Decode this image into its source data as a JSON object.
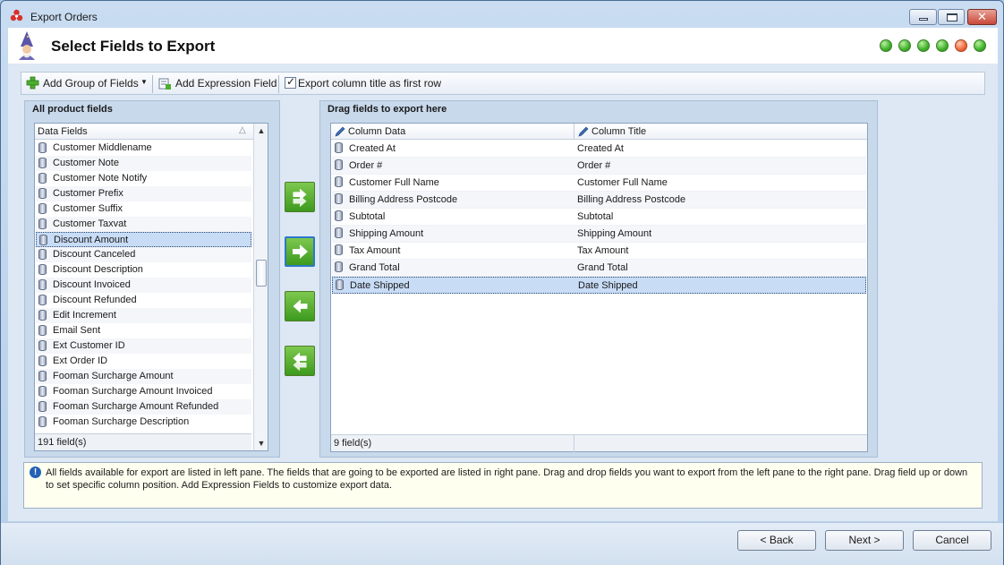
{
  "window": {
    "title": "Export Orders"
  },
  "header": {
    "title": "Select Fields to Export",
    "steps": [
      "done",
      "done",
      "done",
      "done",
      "current",
      "done"
    ]
  },
  "toolbar": {
    "add_group_label": "Add Group of Fields",
    "add_expression_label": "Add Expression Field",
    "export_title_label": "Export column title as first row",
    "export_title_checked": true
  },
  "left_panel": {
    "title": "All product fields",
    "column_header": "Data Fields",
    "items": [
      "Customer Middlename",
      "Customer Note",
      "Customer Note Notify",
      "Customer Prefix",
      "Customer Suffix",
      "Customer Taxvat",
      "Discount Amount",
      "Discount Canceled",
      "Discount Description",
      "Discount Invoiced",
      "Discount Refunded",
      "Edit Increment",
      "Email Sent",
      "Ext Customer ID",
      "Ext Order ID",
      "Fooman Surcharge Amount",
      "Fooman Surcharge Amount Invoiced",
      "Fooman Surcharge Amount Refunded",
      "Fooman Surcharge Description"
    ],
    "selected_index": 6,
    "footer": "191 field(s)"
  },
  "move_buttons": [
    "add-all",
    "add",
    "remove",
    "remove-all"
  ],
  "right_panel": {
    "title": "Drag fields to export here",
    "col1_header": "Column Data",
    "col2_header": "Column Title",
    "rows": [
      {
        "data": "Created At",
        "title": "Created At"
      },
      {
        "data": "Order #",
        "title": "Order #"
      },
      {
        "data": "Customer Full Name",
        "title": "Customer Full Name"
      },
      {
        "data": "Billing Address Postcode",
        "title": "Billing Address Postcode"
      },
      {
        "data": "Subtotal",
        "title": "Subtotal"
      },
      {
        "data": "Shipping Amount",
        "title": "Shipping Amount"
      },
      {
        "data": "Tax Amount",
        "title": "Tax Amount"
      },
      {
        "data": "Grand Total",
        "title": "Grand Total"
      },
      {
        "data": "Date Shipped",
        "title": "Date Shipped"
      }
    ],
    "selected_index": 8,
    "footer": "9 field(s)"
  },
  "info": {
    "text": "All fields available for export are listed in left pane. The fields that are going to be exported are listed in right pane. Drag and drop fields you want to export from the left pane to the right pane. Drag field up or down to set specific column position. Add Expression Fields to customize export data."
  },
  "buttons": {
    "back": "< Back",
    "next": "Next >",
    "cancel": "Cancel"
  }
}
